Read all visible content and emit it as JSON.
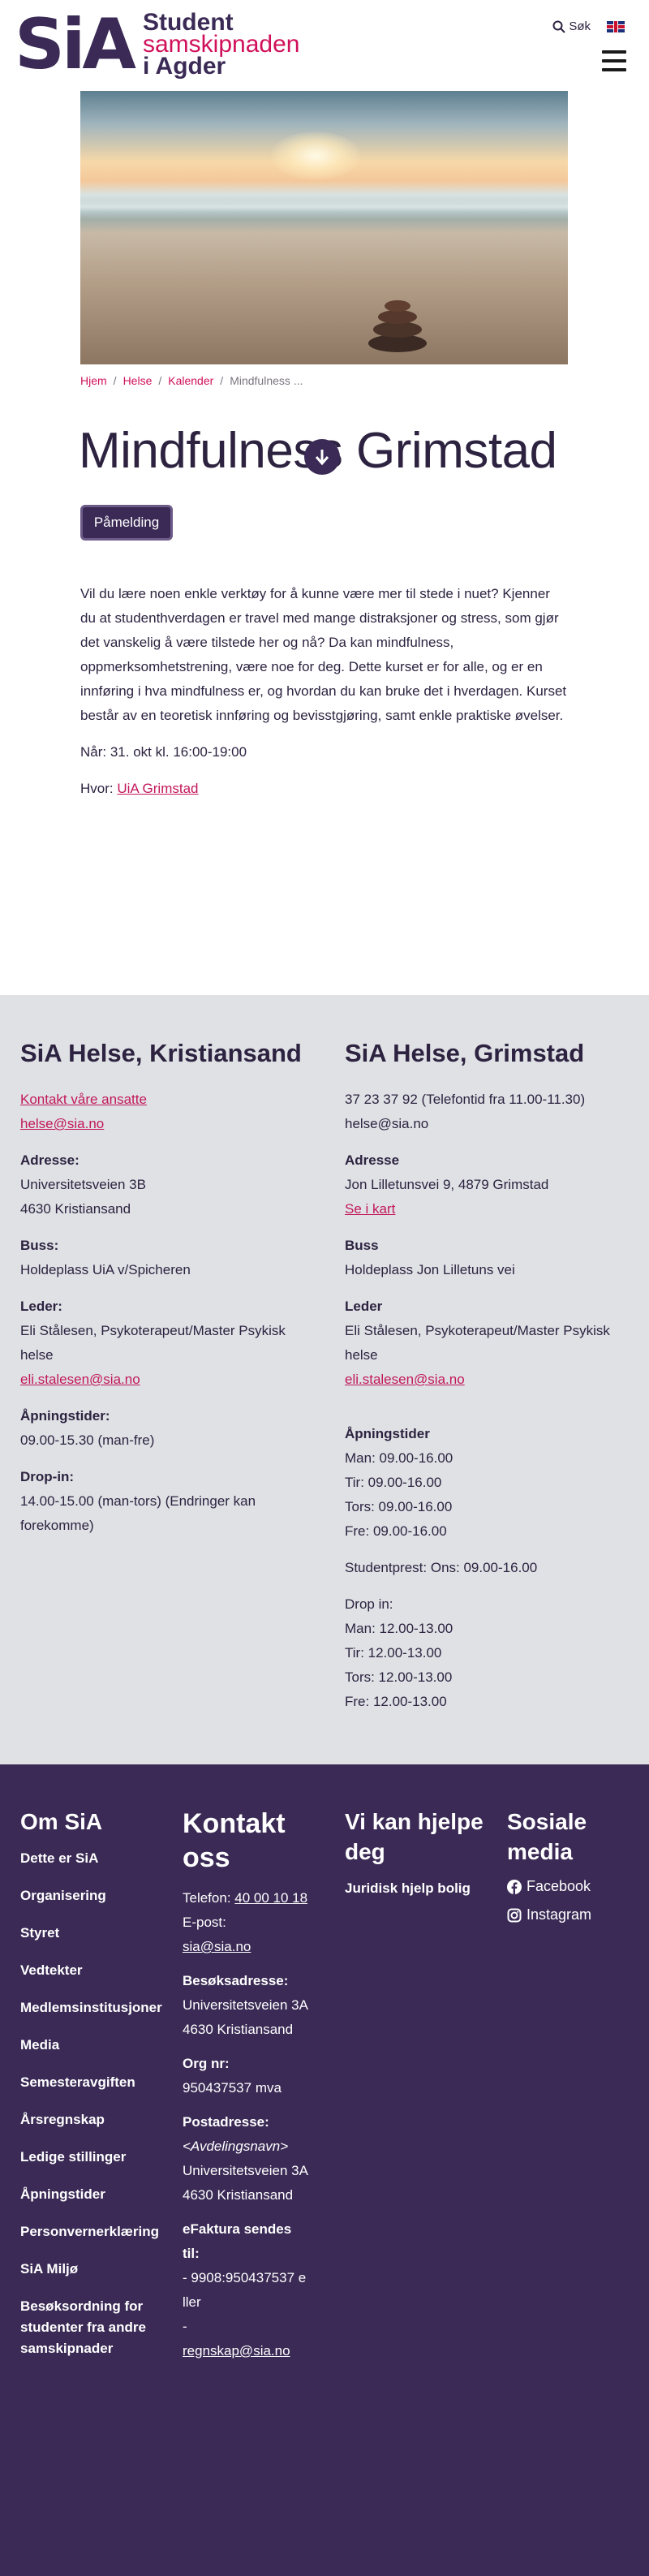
{
  "header": {
    "logo_mark": "SiA",
    "logo_line1": "Student",
    "logo_line2": "samskipnaden",
    "logo_line3": "i Agder",
    "search_label": "Søk",
    "language_icon": "uk-flag-icon",
    "menu_icon": "hamburger-icon"
  },
  "breadcrumb": [
    "Hjem",
    "Helse",
    "Kalender",
    "Mindfulness ..."
  ],
  "event": {
    "title": "Mindfulness Grimstad",
    "signup_label": "Påmelding",
    "description": "Vil du lære noen enkle verktøy for å kunne være mer til stede i nuet? Kjenner du at studenthverdagen er travel med mange distraksjoner og stress, som gjør det vanskelig å være tilstede her og nå? Da kan mindfulness, oppmerksomhetstrening, være noe for deg. Dette kurset er for alle, og er en innføring i hva mindfulness er, og hvordan du kan bruke det i hverdagen. Kurset består av en teoretisk innføring og bevisstgjøring, samt enkle praktiske øvelser.",
    "when": "Når: 31. okt kl. 16:00-19:00",
    "where_label": "Hvor:",
    "where_link": "UiA Grimstad"
  },
  "kristiansand": {
    "heading": "SiA Helse, Kristiansand",
    "contact_link": "Kontakt våre ansatte",
    "email": "helse@sia.no",
    "address_label": "Adresse:",
    "address_line1": "Universitetsveien 3B",
    "address_line2": "4630 Kristiansand",
    "bus_label": "Buss:",
    "bus": "Holdeplass UiA v/Spicheren",
    "leader_label": "Leder:",
    "leader": "Eli Stålesen, Psykoterapeut/Master Psykisk helse",
    "leader_email": "eli.stalesen@sia.no",
    "hours_label": "Åpningstider:",
    "hours": "09.00-15.30 (man-fre)",
    "dropin_label": "Drop-in:",
    "dropin": "14.00-15.00 (man-tors) (Endringer kan forekomme)"
  },
  "grimstad": {
    "heading": "SiA Helse, Grimstad",
    "phone": "37 23 37 92 (Telefontid fra 11.00-11.30)",
    "email": "helse@sia.no",
    "address_label": "Adresse",
    "address": "Jon Lilletunsvei 9, 4879 Grimstad",
    "map_link": "Se i kart",
    "bus_label": "Buss",
    "bus": "Holdeplass Jon Lilletuns vei",
    "leader_label": "Leder",
    "leader": "Eli Stålesen, Psykoterapeut/Master Psykisk helse",
    "leader_email": "eli.stalesen@sia.no",
    "hours_label": "Åpningstider",
    "hours": [
      "Man: 09.00-16.00",
      "Tir: 09.00-16.00",
      "Tors: 09.00-16.00",
      "Fre: 09.00-16.00"
    ],
    "studentprest": "Studentprest: Ons: 09.00-16.00",
    "dropin_label": "Drop in:",
    "dropin": [
      "Man: 12.00-13.00",
      "Tir: 12.00-13.00",
      "Tors: 12.00-13.00",
      "Fre: 12.00-13.00"
    ]
  },
  "footer": {
    "om_heading": "Om SiA",
    "om_links": [
      "Dette er SiA",
      "Organisering",
      "Styret",
      "Vedtekter",
      "Medlemsinstitusjoner",
      "Media",
      "Semesteravgiften",
      "Årsregnskap",
      "Ledige stillinger",
      "Åpningstider",
      "Personvernerklæring",
      "SiA Miljø",
      "Besøksordning for studenter fra andre samskipnader"
    ],
    "kontakt_heading": "Kontakt oss",
    "phone_label": "Telefon:",
    "phone": "40 00 10 18",
    "email_label": "E-post:",
    "email": "sia@sia.no",
    "visit_label": "Besøksadresse:",
    "visit_line1": "Universitetsveien 3A",
    "visit_line2": "4630 Kristiansand",
    "org_label": "Org nr:",
    "org": "950437537 mva",
    "post_label": "Postadresse:",
    "post_line1": "<Avdelingsnavn>",
    "post_line2": "Universitetsveien 3A",
    "post_line3": "4630 Kristiansand",
    "efaktura_label": "eFaktura sendes til:",
    "efaktura_line1": "- 9908:950437537 eller",
    "efaktura_dash": "-",
    "efaktura_email": "regnskap@sia.no",
    "help_heading": "Vi kan hjelpe deg",
    "help_links": [
      "Juridisk hjelp bolig"
    ],
    "social_heading": "Sosiale media",
    "social_links": [
      "Facebook",
      "Instagram"
    ]
  }
}
